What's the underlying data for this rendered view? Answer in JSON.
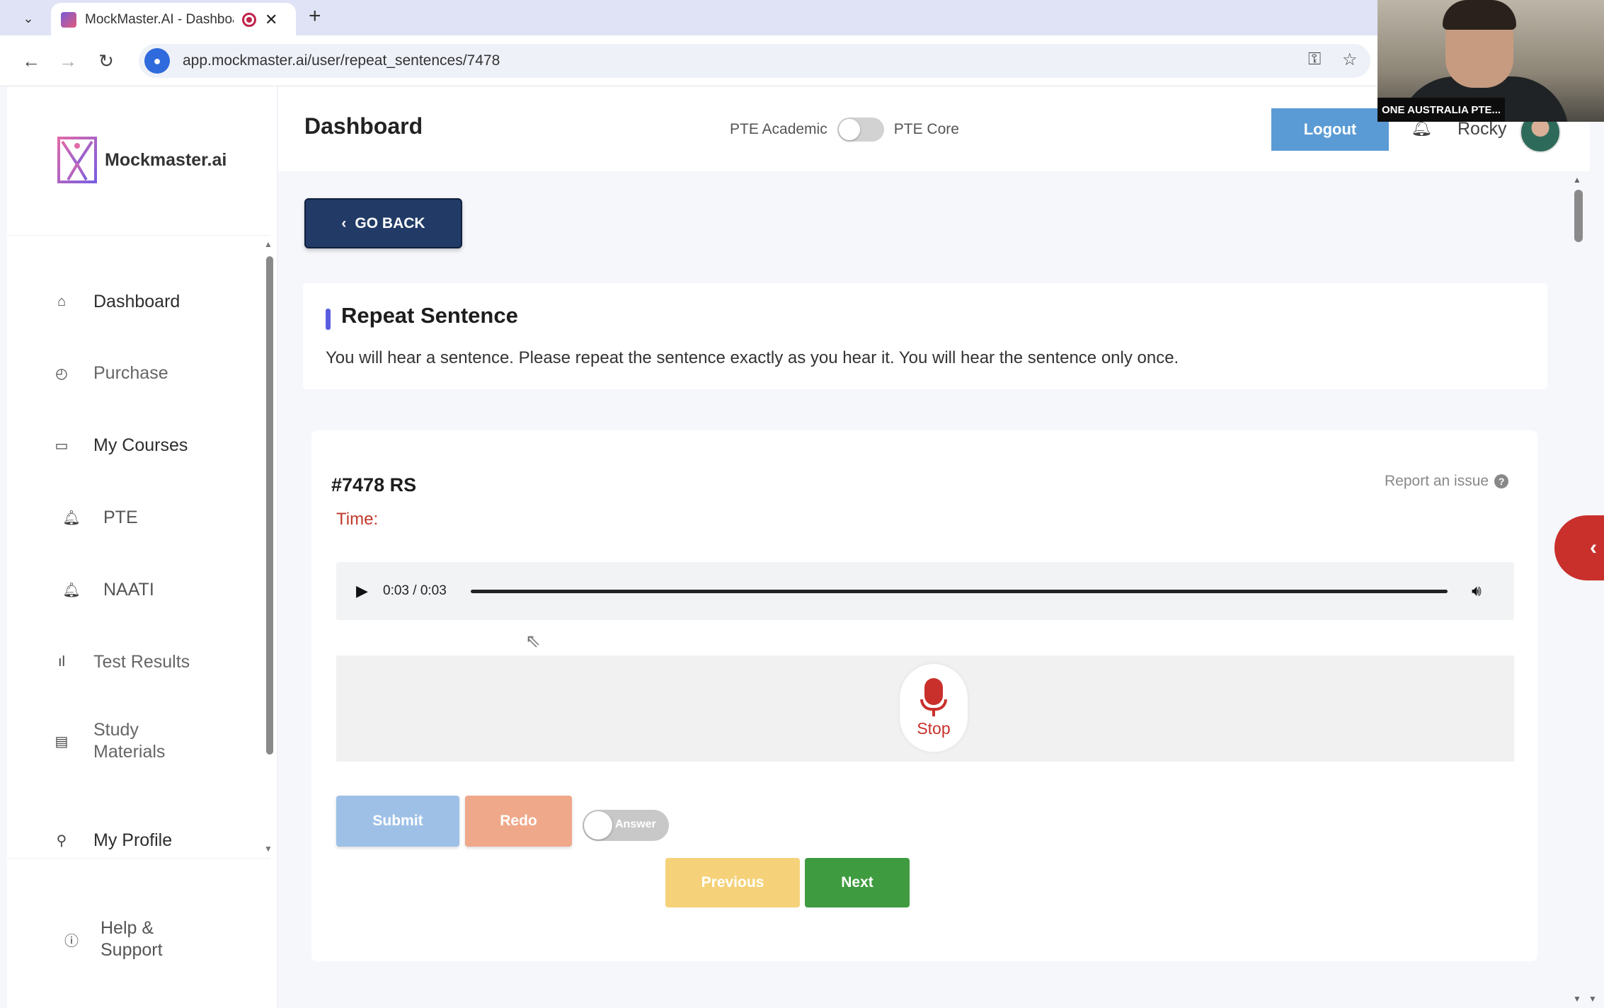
{
  "browser": {
    "tab_title": "MockMaster.AI - Dashboard",
    "url": "app.mockmaster.ai/user/repeat_sentences/7478"
  },
  "webcam": {
    "caption": "ONE AUSTRALIA PTE..."
  },
  "brand": {
    "name": "Mockmaster.ai"
  },
  "sidebar": {
    "items": [
      {
        "label": "Dashboard",
        "icon": "home-icon"
      },
      {
        "label": "Purchase",
        "icon": "check-circle-icon"
      },
      {
        "label": "My Courses",
        "icon": "book-icon"
      },
      {
        "label": "PTE",
        "icon": "bell-icon"
      },
      {
        "label": "NAATI",
        "icon": "bell-icon"
      },
      {
        "label": "Test Results",
        "icon": "bar-chart-icon"
      },
      {
        "label": "Study Materials",
        "icon": "notebook-icon"
      },
      {
        "label": "My Profile",
        "icon": "user-icon"
      }
    ],
    "help": {
      "label": "Help & Support",
      "icon": "question-circle-icon"
    }
  },
  "header": {
    "title": "Dashboard",
    "mode_left": "PTE Academic",
    "mode_right": "PTE Core",
    "logout_label": "Logout",
    "username": "Rocky"
  },
  "main": {
    "go_back_label": "GO BACK",
    "section_title": "Repeat Sentence",
    "instructions": "You will hear a sentence. Please repeat the sentence exactly as you hear it. You will hear the sentence only once.",
    "question_id": "#7478 RS",
    "report_label": "Report an issue",
    "time_label": "Time:",
    "audio": {
      "time": "0:03 / 0:03",
      "progress": 1.0
    },
    "record_label": "Stop",
    "submit_label": "Submit",
    "redo_label": "Redo",
    "answer_label": "Answer",
    "previous_label": "Previous",
    "next_label": "Next"
  },
  "colors": {
    "accent_blue": "#213b66",
    "logout_blue": "#5b9bd5",
    "record_red": "#c9302c",
    "next_green": "#3f9b3f",
    "previous_yellow": "#f5d27a",
    "redo_orange": "#f0a88a",
    "submit_blue": "#9ec0e6"
  }
}
